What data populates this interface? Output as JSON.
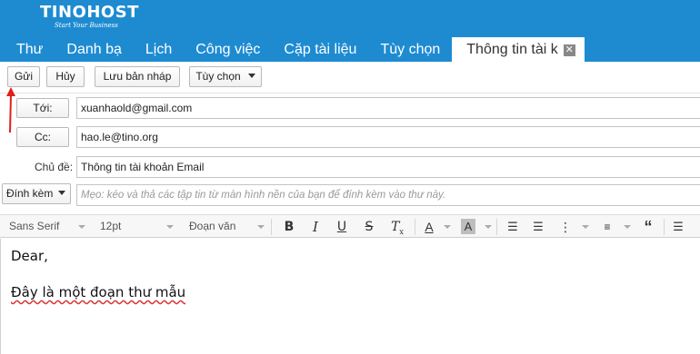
{
  "brand": {
    "logo_text": "TINOHOST",
    "tagline": "Start Your Business"
  },
  "tabs": [
    {
      "label": "Thư"
    },
    {
      "label": "Danh bạ"
    },
    {
      "label": "Lịch"
    },
    {
      "label": "Công việc"
    },
    {
      "label": "Cặp tài liệu"
    },
    {
      "label": "Tùy chọn"
    },
    {
      "label": "Thông tin tài k",
      "active": true
    }
  ],
  "toolbar": {
    "send_label": "Gửi",
    "cancel_label": "Hủy",
    "save_draft_label": "Lưu bản nháp",
    "options_label": "Tùy chọn"
  },
  "compose": {
    "to_label": "Tới:",
    "to_value": "xuanhaold@gmail.com",
    "cc_label": "Cc:",
    "cc_value": "hao.le@tino.org",
    "subject_label": "Chủ đề:",
    "subject_value": "Thông tin tài khoản Email",
    "attach_label": "Đính kèm",
    "attach_hint": "Mẹo: kéo và thả các tập tin từ màn hình nền của bạn để đính kèm vào thư này."
  },
  "format": {
    "font_family": "Sans Serif",
    "font_size": "12pt",
    "paragraph": "Đoạn văn"
  },
  "editor": {
    "line1": "Dear,",
    "line2": "Đây là một đoạn thư mẫu"
  },
  "colors": {
    "header_bg": "#1e8bd1",
    "annotation_arrow": "#e0201c"
  }
}
